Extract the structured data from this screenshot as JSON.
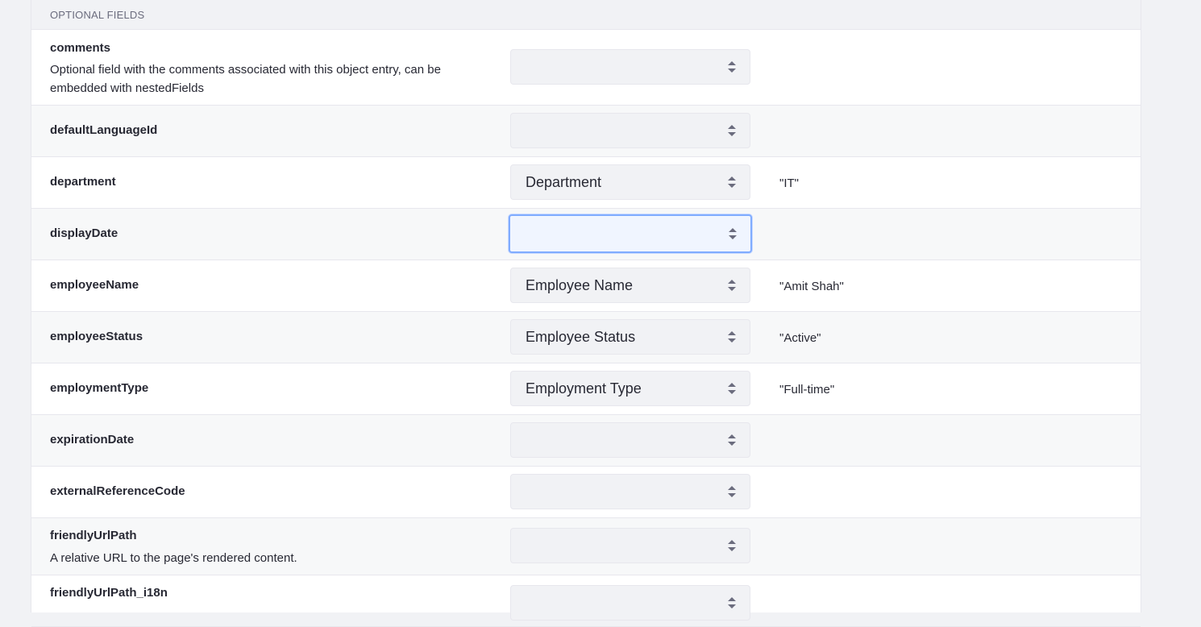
{
  "section": {
    "title": "OPTIONAL FIELDS"
  },
  "rows": [
    {
      "name": "comments",
      "description": "Optional field with the comments associated with this object entry, can be embedded with nestedFields",
      "select": "",
      "value": ""
    },
    {
      "name": "defaultLanguageId",
      "description": "",
      "select": "",
      "value": ""
    },
    {
      "name": "department",
      "description": "",
      "select": "Department",
      "value": "\"IT\""
    },
    {
      "name": "displayDate",
      "description": "",
      "select": "",
      "value": ""
    },
    {
      "name": "employeeName",
      "description": "",
      "select": "Employee Name",
      "value": "\"Amit Shah\""
    },
    {
      "name": "employeeStatus",
      "description": "",
      "select": "Employee Status",
      "value": "\"Active\""
    },
    {
      "name": "employmentType",
      "description": "",
      "select": "Employment Type",
      "value": "\"Full-time\""
    },
    {
      "name": "expirationDate",
      "description": "",
      "select": "",
      "value": ""
    },
    {
      "name": "externalReferenceCode",
      "description": "",
      "select": "",
      "value": ""
    },
    {
      "name": "friendlyUrlPath",
      "description": "A relative URL to the page's rendered content.",
      "select": "",
      "value": ""
    },
    {
      "name": "friendlyUrlPath_i18n",
      "description": "",
      "select": "",
      "value": ""
    }
  ],
  "icons": {
    "select_arrows": "sort-arrows-icon"
  },
  "colors": {
    "focus_border": "#80acff",
    "focus_bg": "#f0f5ff"
  }
}
